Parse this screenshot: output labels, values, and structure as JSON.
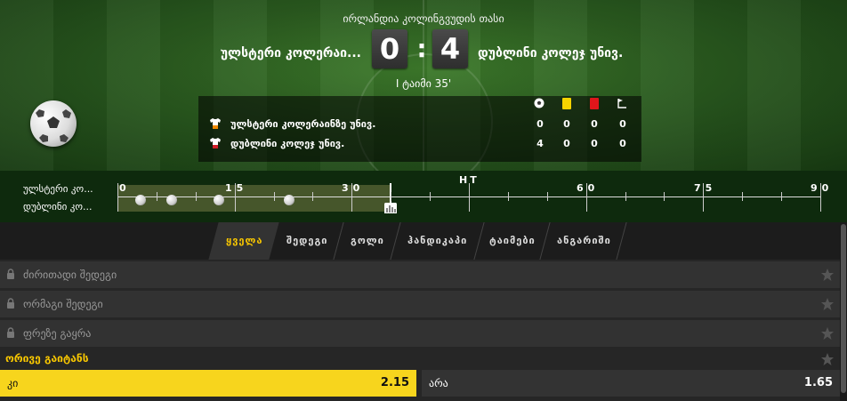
{
  "header": {
    "league": "ირლანდია კოლინგვუდის თასი",
    "home_team": "ულსტერი კოლერაი...",
    "away_team": "დუბლინი კოლეჯ უნივ.",
    "home_score": "0",
    "score_separator": ":",
    "away_score": "4",
    "match_time": "I ტაიმი 35'"
  },
  "stats": {
    "icons": [
      "goal-ball-icon",
      "yellow-card-icon",
      "red-card-icon",
      "corner-flag-icon"
    ],
    "rows": [
      {
        "team": "ულსტერი კოლერაინზე უნივ.",
        "values": [
          "0",
          "0",
          "0",
          "0"
        ]
      },
      {
        "team": "დუბლინი კოლეჯ უნივ.",
        "values": [
          "4",
          "0",
          "0",
          "0"
        ]
      }
    ]
  },
  "timeline": {
    "home_label": "ულსტერი კო...",
    "away_label": "დუბლინი კო...",
    "ticks": [
      "0",
      "15",
      "30",
      "60",
      "75",
      "90"
    ],
    "half_time": "HT",
    "current_minute": 35,
    "goal_minutes": [
      3,
      7,
      13,
      22
    ]
  },
  "tabs": [
    {
      "label": "ყველა",
      "active": true
    },
    {
      "label": "შედეგი",
      "active": false
    },
    {
      "label": "გოლი",
      "active": false
    },
    {
      "label": "ჰანდიკაპი",
      "active": false
    },
    {
      "label": "ტაიმები",
      "active": false
    },
    {
      "label": "ანგარიში",
      "active": false
    }
  ],
  "markets": {
    "locked": [
      "ძირითადი შედეგი",
      "ორმაგი შედეგი",
      "ფრეზე გაყრა"
    ],
    "open_title": "ორივე გაიტანს",
    "odds": [
      {
        "name": "კი",
        "value": "2.15",
        "selected": true
      },
      {
        "name": "არა",
        "value": "1.65",
        "selected": false
      }
    ]
  },
  "colors": {
    "accent": "#f7c600",
    "selected_odd": "#f7d51d",
    "yellow_card": "#f5d300",
    "red_card": "#e0161b"
  }
}
